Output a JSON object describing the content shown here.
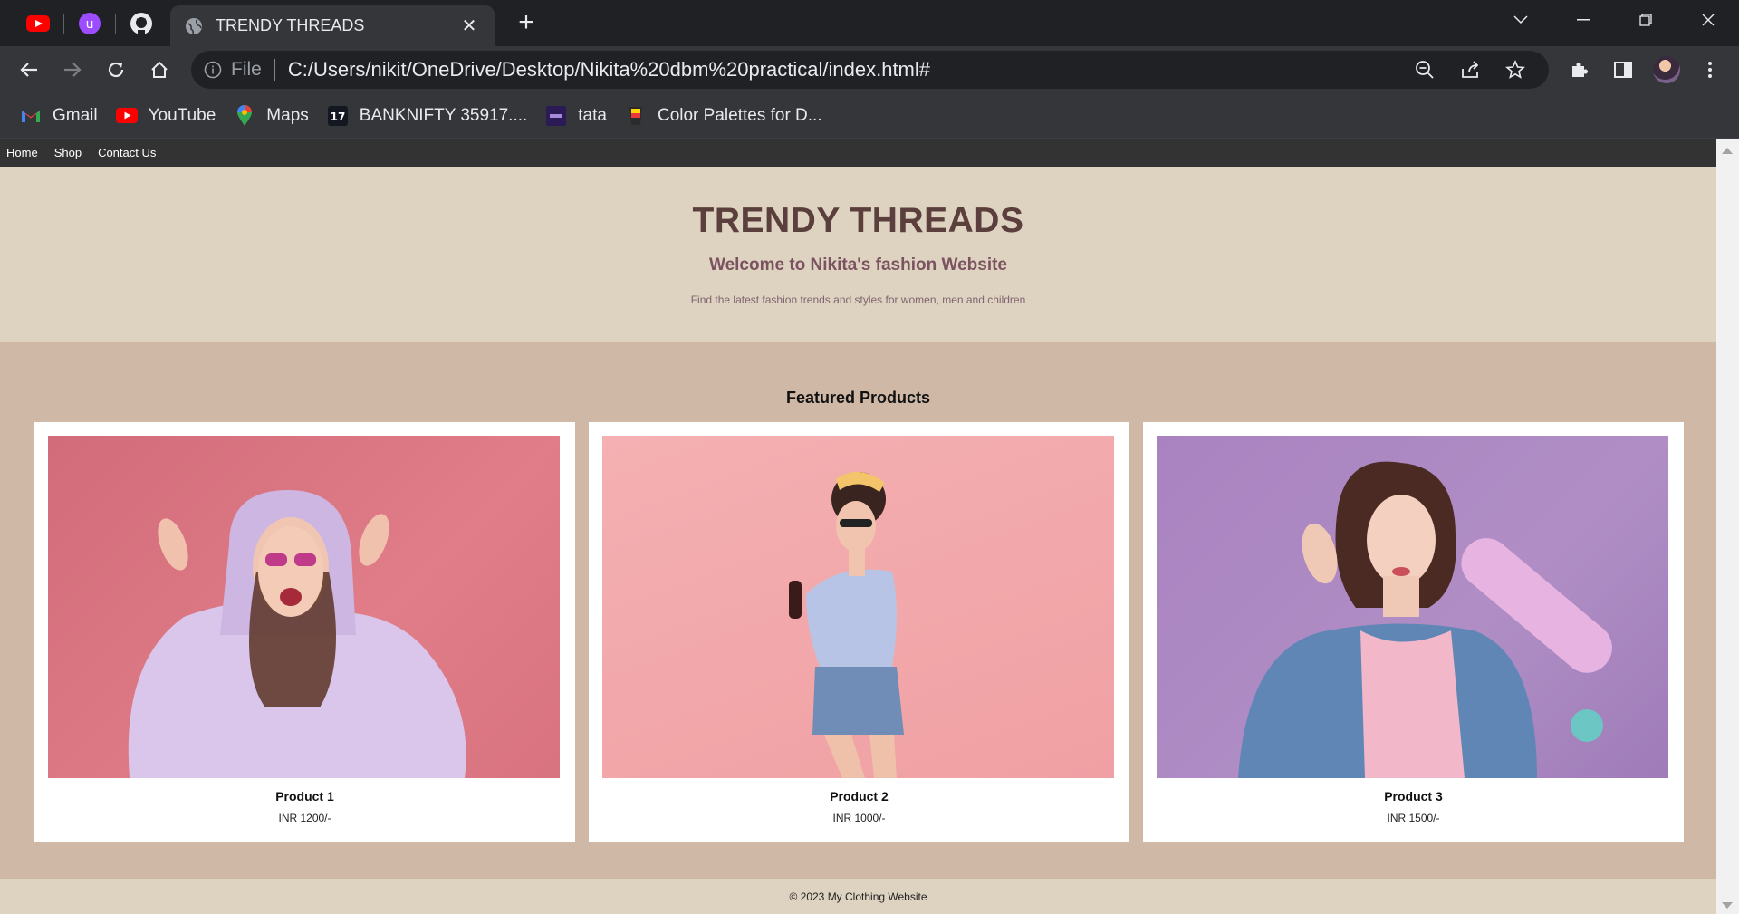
{
  "browser": {
    "tab_title": "TRENDY THREADS",
    "url_scheme": "File",
    "url": "C:/Users/nikit/OneDrive/Desktop/Nikita%20dbm%20practical/index.html#",
    "bookmarks": [
      {
        "label": "Gmail",
        "icon": "gmail-icon"
      },
      {
        "label": "YouTube",
        "icon": "youtube-icon"
      },
      {
        "label": "Maps",
        "icon": "maps-icon"
      },
      {
        "label": "BANKNIFTY 35917....",
        "icon": "tradingview-icon"
      },
      {
        "label": "tata",
        "icon": "tata-icon"
      },
      {
        "label": "Color Palettes for D...",
        "icon": "palette-icon"
      }
    ]
  },
  "site": {
    "nav": [
      "Home",
      "Shop",
      "Contact Us"
    ],
    "hero": {
      "title": "TRENDY THREADS",
      "subtitle": "Welcome to Nikita's fashion Website",
      "tagline": "Find the latest fashion trends and styles for women, men and children"
    },
    "featured_heading": "Featured Products",
    "products": [
      {
        "name": "Product 1",
        "price": "INR 1200/-",
        "bg": "#d8737f"
      },
      {
        "name": "Product 2",
        "price": "INR 1000/-",
        "bg": "#f2a4a6"
      },
      {
        "name": "Product 3",
        "price": "INR 1500/-",
        "bg": "#a985bd"
      }
    ],
    "footer": "© 2023 My Clothing Website"
  },
  "colors": {
    "nav_bg": "#333333",
    "hero_bg": "#ded2c0",
    "featured_bg": "#cfb9a6",
    "title": "#5a3f3c",
    "subtitle": "#7b5360"
  }
}
